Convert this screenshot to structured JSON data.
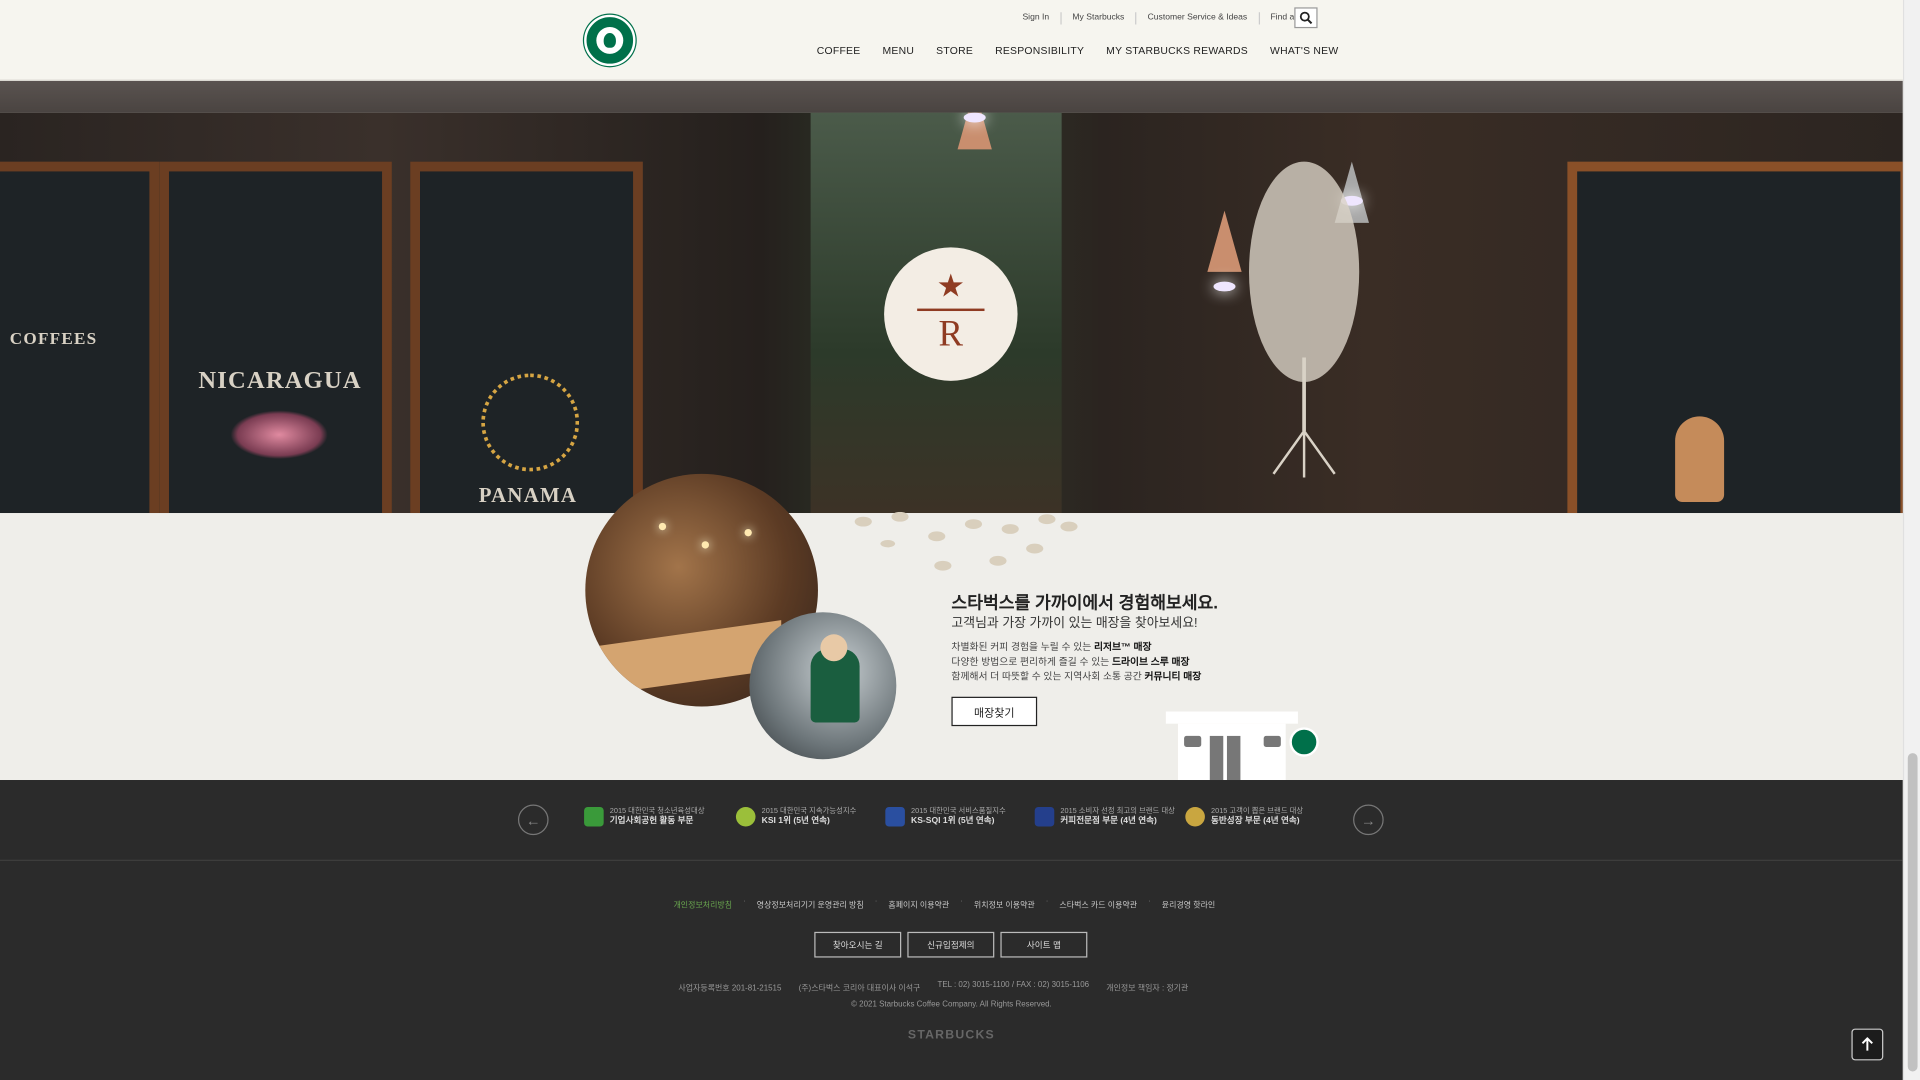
{
  "header": {
    "utility_links": [
      "Sign In",
      "My Starbucks",
      "Customer Service & Ideas",
      "Find a Store"
    ],
    "nav": [
      "COFFEE",
      "MENU",
      "STORE",
      "RESPONSIBILITY",
      "MY STARBUCKS REWARDS",
      "WHAT'S NEW"
    ],
    "search_icon": "search-icon",
    "logo_icon": "starbucks-siren-logo"
  },
  "hero": {
    "boards": [
      "NICARAGUA",
      "PANAMA",
      "COFFEES"
    ],
    "badge_letter": "R",
    "badge_star": "★"
  },
  "store": {
    "title": "스타벅스를 가까이에서 경험해보세요.",
    "subtitle": "고객님과 가장 가까이 있는 매장을 찾아보세요!",
    "lines": [
      {
        "text": "차별화된 커피 경험을 누릴 수 있는 ",
        "bold": "리저브™ 매장"
      },
      {
        "text": "다양한 방법으로 편리하게 즐길 수 있는 ",
        "bold": "드라이브 스루 매장"
      },
      {
        "text": "함께해서 더 따뜻할 수 있는 지역사회 소통 공간 ",
        "bold": "커뮤니티 매장"
      }
    ],
    "button": "매장찾기"
  },
  "awards": [
    {
      "line1": "2015 대한민국 청소년육성대상",
      "line2": "기업사회공헌 활동 부문",
      "color": "#3a9a3a"
    },
    {
      "line1": "2015 대한민국 지속가능성지수",
      "line2": "KSI 1위 (5년 연속)",
      "color": "#9bbf3a"
    },
    {
      "line1": "2015 대한민국 서비스품질지수",
      "line2": "KS-SQI 1위 (5년 연속)",
      "color": "#2a4fa0"
    },
    {
      "line1": "2015 소비자 선정 최고의 브랜드 대상",
      "line2": "커피전문점 부문 (4년 연속)",
      "color": "#243f8c"
    },
    {
      "line1": "2015 고객이 뽑은 브랜드 대상",
      "line2": "동반성장 부문 (4년 연속)",
      "color": "#c9a640"
    }
  ],
  "footer": {
    "policies": [
      "개인정보처리방침",
      "영상정보처리기기 운영관리 방침",
      "홈페이지 이용약관",
      "위치정보 이용약관",
      "스타벅스 카드 이용약관",
      "윤리경영 핫라인"
    ],
    "buttons": [
      "찾아오시는 길",
      "신규입점제의",
      "사이트 맵"
    ],
    "biz": [
      "사업자등록번호 201-81-21515",
      "(주)스타벅스 코리아 대표이사 이석구",
      "TEL : 02) 3015-1100 / FAX : 02) 3015-1106",
      "개인정보 책임자 : 정기관"
    ],
    "copyright": "© 2021 Starbucks Coffee Company. All Rights Reserved.",
    "wordmark": "STARBUCKS"
  },
  "colors": {
    "brand_green": "#00704a",
    "reserve_brown": "#8f3b22",
    "policy_highlight": "#6aa84f"
  }
}
